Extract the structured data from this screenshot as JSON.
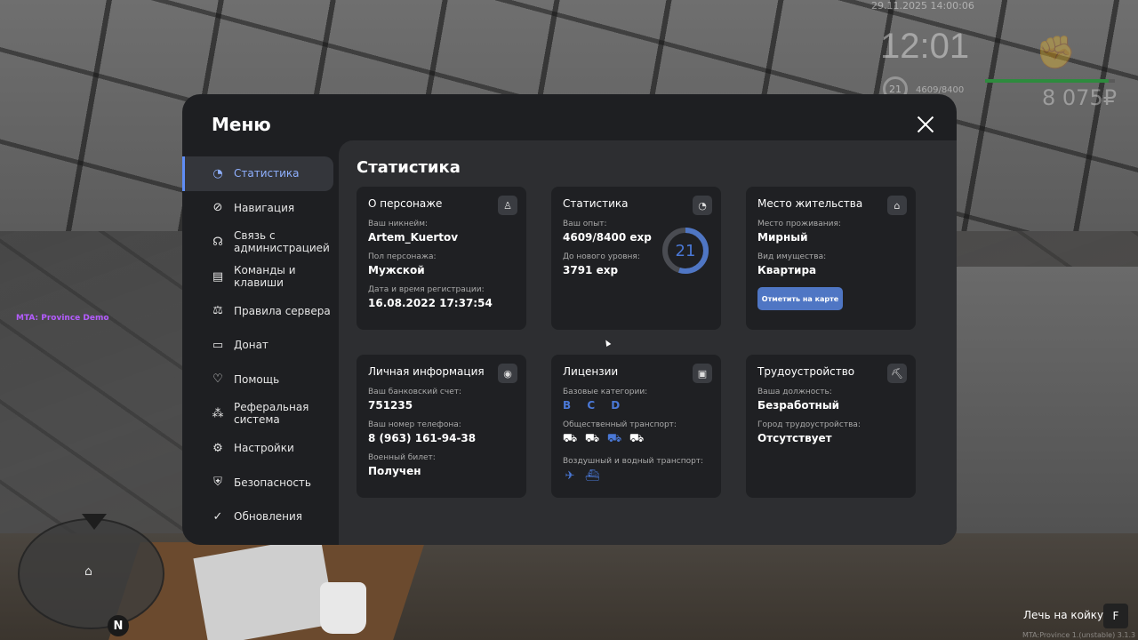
{
  "hud": {
    "datetime": "29.11.2025 14:00:06",
    "clock": "12:01",
    "level": "21",
    "exp": "4609/8400",
    "health_fraction": 0.95,
    "money": "8 075₽",
    "server_name": "MTA: Province Demo",
    "action_hint": "Лечь на койку",
    "action_key": "F",
    "footer_version": "MTA:Province 1.(unstable) 3.1.3"
  },
  "menu": {
    "title": "Меню",
    "nav": [
      {
        "label": "Статистика",
        "icon": "pie-chart-icon",
        "active": true
      },
      {
        "label": "Навигация",
        "icon": "compass-icon"
      },
      {
        "label": "Связь с администрацией",
        "icon": "headset-icon"
      },
      {
        "label": "Команды и клавиши",
        "icon": "document-icon"
      },
      {
        "label": "Правила сервера",
        "icon": "scales-icon"
      },
      {
        "label": "Донат",
        "icon": "wallet-icon"
      },
      {
        "label": "Помощь",
        "icon": "handshake-icon"
      },
      {
        "label": "Реферальная система",
        "icon": "network-icon"
      },
      {
        "label": "Настройки",
        "icon": "gear-icon"
      },
      {
        "label": "Безопасность",
        "icon": "shield-icon"
      },
      {
        "label": "Обновления",
        "icon": "refresh-check-icon"
      }
    ],
    "accent_color": "#5f8df5"
  },
  "stats": {
    "title": "Статистика",
    "character": {
      "title": "О персонаже",
      "nickname_label": "Ваш никнейм:",
      "nickname": "Artem_Kuertov",
      "gender_label": "Пол персонажа:",
      "gender": "Мужской",
      "reg_label": "Дата и время регистрации:",
      "reg": "16.08.2022 17:37:54"
    },
    "statistics": {
      "title": "Статистика",
      "exp_label": "Ваш опыт:",
      "exp": "4609/8400 exp",
      "next_label": "До нового уровня:",
      "next": "3791 exp",
      "level": "21",
      "progress": 0.549
    },
    "residence": {
      "title": "Место жительства",
      "place_label": "Место проживания:",
      "place": "Мирный",
      "property_label": "Вид имущества:",
      "property": "Квартира",
      "map_button": "Отметить на карте"
    },
    "personal": {
      "title": "Личная информация",
      "bank_label": "Ваш банковский счет:",
      "bank": "751235",
      "phone_label": "Ваш номер телефона:",
      "phone": "8 (963) 161-94-38",
      "military_label": "Военный билет:",
      "military": "Получен"
    },
    "licenses": {
      "title": "Лицензии",
      "base_label": "Базовые категории:",
      "base": "B C D",
      "public_label": "Общественный транспорт:",
      "air_label": "Воздушный и водный транспорт:"
    },
    "employment": {
      "title": "Трудоустройство",
      "position_label": "Ваша должность:",
      "position": "Безработный",
      "city_label": "Город трудоустройства:",
      "city": "Отсутствует"
    }
  }
}
